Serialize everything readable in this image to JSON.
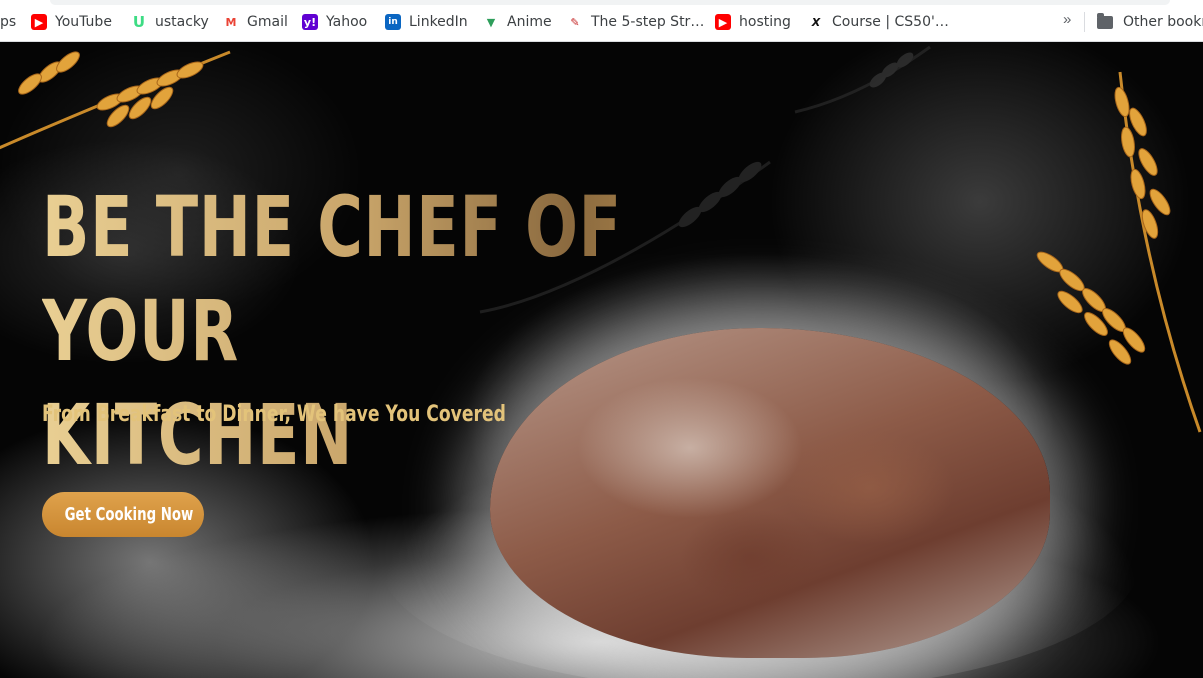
{
  "bookmarks_bar": {
    "items": [
      {
        "label": "ps",
        "icon": "apps-icon"
      },
      {
        "label": "YouTube",
        "icon": "youtube-icon"
      },
      {
        "label": "ustacky",
        "icon": "ustacky-icon"
      },
      {
        "label": "Gmail",
        "icon": "gmail-icon"
      },
      {
        "label": "Yahoo",
        "icon": "yahoo-icon"
      },
      {
        "label": "LinkedIn",
        "icon": "linkedin-icon"
      },
      {
        "label": "Anime",
        "icon": "anime-icon"
      },
      {
        "label": "The 5-step Str…",
        "icon": "article-icon"
      },
      {
        "label": "hosting",
        "icon": "youtube-icon"
      },
      {
        "label": "Course | CS50'…",
        "icon": "edx-icon"
      }
    ],
    "overflow_label": "»",
    "other_bookmarks_label": "Other bookmarks"
  },
  "hero": {
    "headline_line1": "BE THE CHEF OF YOUR",
    "headline_line2": "KITCHEN",
    "tagline": "From Breakfast to Dinner, We have You Covered",
    "cta_label": "Get Cooking Now"
  },
  "colors": {
    "gold_text": "#e3c37a",
    "button": "#d4923c",
    "background": "#050505"
  }
}
